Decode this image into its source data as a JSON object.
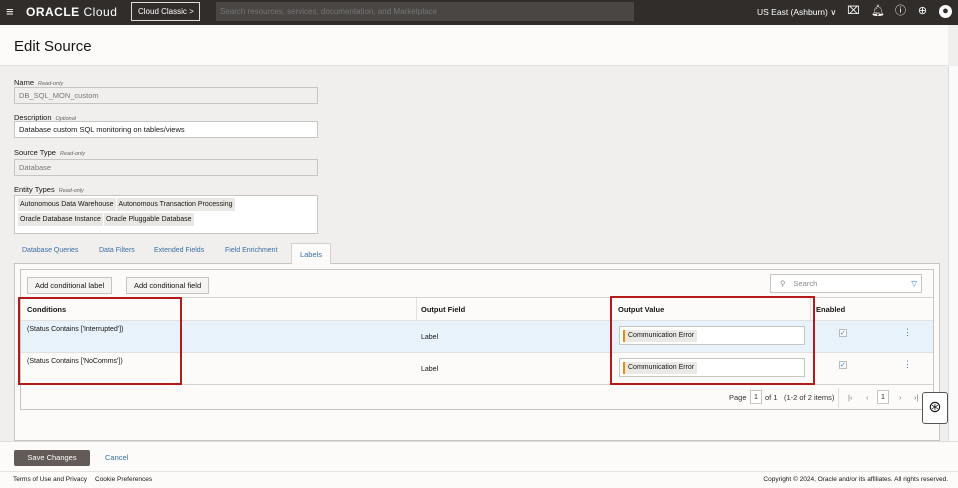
{
  "topbar": {
    "brand": "ORACLE",
    "brand_suffix": "Cloud",
    "classic": "Cloud Classic >",
    "search_placeholder": "Search resources, services, documentation, and Marketplace",
    "region": "US East (Ashburn)"
  },
  "page": {
    "title": "Edit Source"
  },
  "form": {
    "name_label": "Name",
    "name_hint": "Read-only",
    "name_value": "DB_SQL_MON_custom",
    "desc_label": "Description",
    "desc_hint": "Optional",
    "desc_value": "Database custom SQL monitoring on tables/views",
    "type_label": "Source Type",
    "type_hint": "Read-only",
    "type_value": "Database",
    "entity_label": "Entity Types",
    "entity_hint": "Read-only",
    "entity_types": [
      "Autonomous Data Warehouse",
      "Autonomous Transaction Processing",
      "Oracle Database Instance",
      "Oracle Pluggable Database"
    ]
  },
  "tabs": [
    "Database Queries",
    "Data Filters",
    "Extended Fields",
    "Field Enrichment",
    "Labels"
  ],
  "labels": {
    "add_label": "Add conditional label",
    "add_field": "Add conditional field",
    "search_placeholder": "Search",
    "columns": [
      "Conditions",
      "Output Field",
      "Output Value",
      "Enabled"
    ],
    "rows": [
      {
        "condition": "(Status Contains ['Interrupted'])",
        "field": "Label",
        "value": "Communication Error",
        "enabled": true
      },
      {
        "condition": "(Status Contains ['NoComms'])",
        "field": "Label",
        "value": "Communication Error",
        "enabled": true
      }
    ],
    "page_label": "Page",
    "page": "1",
    "of": "of 1",
    "items": "(1-2 of 2 items)",
    "current": "1"
  },
  "actions": {
    "save": "Save Changes",
    "cancel": "Cancel"
  },
  "footer": {
    "terms": "Terms of Use and Privacy",
    "cookies": "Cookie Preferences",
    "copyright": "Copyright © 2024, Oracle and/or its affiliates. All rights reserved."
  }
}
